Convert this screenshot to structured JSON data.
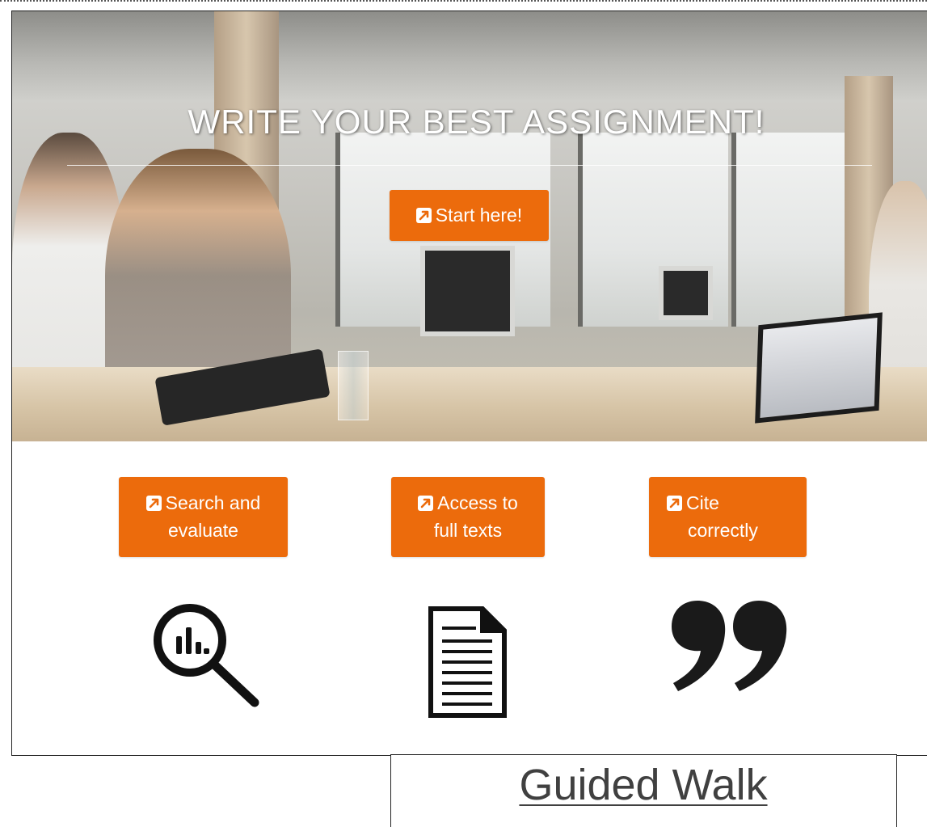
{
  "hero": {
    "title": "WRITE YOUR BEST ASSIGNMENT!",
    "start_button": {
      "label": "Start here!",
      "icon": "external-link-icon"
    }
  },
  "actions": [
    {
      "line1": "Search and",
      "line2": "evaluate",
      "icon": "external-link-icon",
      "illustration": "magnifier-chart-icon"
    },
    {
      "line1": "Access to",
      "line2": "full texts",
      "icon": "external-link-icon",
      "illustration": "document-icon"
    },
    {
      "line1": "Cite",
      "line2": "correctly",
      "icon": "external-link-icon",
      "illustration": "quotation-marks-icon"
    }
  ],
  "footer": {
    "guided_walk_link": "Guided Walk"
  },
  "colors": {
    "button_background": "#ec6b0c",
    "button_text": "#ffffff",
    "link_text": "#404040"
  }
}
